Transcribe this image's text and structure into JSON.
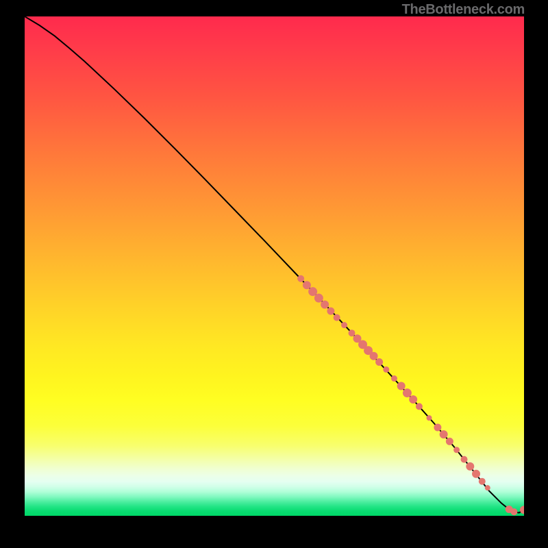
{
  "attribution": "TheBottleneck.com",
  "colors": {
    "dot_fill": "#e4766f",
    "line_stroke": "#000000"
  },
  "chart_data": {
    "type": "line",
    "title": "",
    "xlabel": "",
    "ylabel": "",
    "xlim": [
      0,
      100
    ],
    "ylim": [
      0,
      100
    ],
    "grid": false,
    "legend": false,
    "series": [
      {
        "name": "bottleneck-curve",
        "x": [
          0,
          3,
          6,
          9,
          12,
          18,
          24,
          30,
          36,
          42,
          48,
          54,
          60,
          66,
          72,
          78,
          82,
          86,
          90,
          93,
          95.5,
          97,
          98,
          99,
          100
        ],
        "y": [
          100,
          98.2,
          96.1,
          93.6,
          91.0,
          85.4,
          79.6,
          73.6,
          67.5,
          61.3,
          55.1,
          48.8,
          42.5,
          36.1,
          29.6,
          23.0,
          18.5,
          13.8,
          8.8,
          5.0,
          2.5,
          1.3,
          0.8,
          0.6,
          1.2
        ]
      }
    ],
    "points": [
      {
        "x": 55.3,
        "y": 47.5,
        "r": 5
      },
      {
        "x": 56.5,
        "y": 46.2,
        "r": 6
      },
      {
        "x": 57.7,
        "y": 44.9,
        "r": 6.5
      },
      {
        "x": 58.9,
        "y": 43.6,
        "r": 6.5
      },
      {
        "x": 60.1,
        "y": 42.3,
        "r": 6
      },
      {
        "x": 61.3,
        "y": 41.0,
        "r": 5.5
      },
      {
        "x": 62.5,
        "y": 39.7,
        "r": 5
      },
      {
        "x": 64.0,
        "y": 38.2,
        "r": 4.5
      },
      {
        "x": 65.5,
        "y": 36.6,
        "r": 5
      },
      {
        "x": 66.6,
        "y": 35.5,
        "r": 6
      },
      {
        "x": 67.7,
        "y": 34.3,
        "r": 6.5
      },
      {
        "x": 68.8,
        "y": 33.1,
        "r": 6.5
      },
      {
        "x": 69.9,
        "y": 32.0,
        "r": 6
      },
      {
        "x": 71.0,
        "y": 30.8,
        "r": 5.5
      },
      {
        "x": 72.4,
        "y": 29.3,
        "r": 4.5
      },
      {
        "x": 74.0,
        "y": 27.5,
        "r": 4.5
      },
      {
        "x": 75.4,
        "y": 26.0,
        "r": 6
      },
      {
        "x": 76.6,
        "y": 24.6,
        "r": 6.5
      },
      {
        "x": 77.8,
        "y": 23.3,
        "r": 6
      },
      {
        "x": 79.0,
        "y": 21.9,
        "r": 5
      },
      {
        "x": 81.0,
        "y": 19.6,
        "r": 4
      },
      {
        "x": 82.7,
        "y": 17.7,
        "r": 5.5
      },
      {
        "x": 83.9,
        "y": 16.3,
        "r": 6
      },
      {
        "x": 85.1,
        "y": 14.9,
        "r": 5.5
      },
      {
        "x": 86.5,
        "y": 13.2,
        "r": 4.5
      },
      {
        "x": 88.0,
        "y": 11.3,
        "r": 5
      },
      {
        "x": 89.2,
        "y": 9.9,
        "r": 6
      },
      {
        "x": 90.4,
        "y": 8.4,
        "r": 6
      },
      {
        "x": 91.6,
        "y": 6.9,
        "r": 5
      },
      {
        "x": 92.7,
        "y": 5.6,
        "r": 4
      },
      {
        "x": 97.0,
        "y": 1.3,
        "r": 5.5
      },
      {
        "x": 98.0,
        "y": 0.8,
        "r": 5
      },
      {
        "x": 100.0,
        "y": 1.2,
        "r": 6
      }
    ]
  }
}
